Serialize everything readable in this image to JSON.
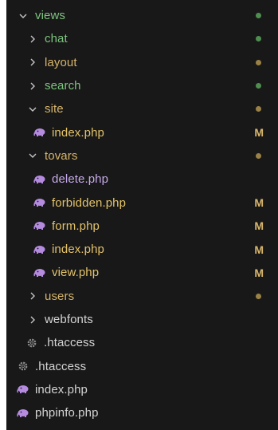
{
  "explorer": {
    "colors": {
      "folder_modified": "#d7b56b",
      "folder_untracked": "#7dc47f",
      "file_modified": "#e2c26a",
      "file_default": "#c5a9e8",
      "dot_green": "#4e8f4f",
      "dot_yellow": "#9a8246",
      "m_badge": "#d7b56b"
    },
    "items": [
      {
        "label": "views",
        "kind": "folder",
        "expanded": true,
        "icon": "chevron-down-icon",
        "status": "dot-green"
      },
      {
        "label": "chat",
        "kind": "folder",
        "expanded": false,
        "icon": "chevron-right-icon",
        "status": "dot-green"
      },
      {
        "label": "layout",
        "kind": "folder",
        "expanded": false,
        "icon": "chevron-right-icon",
        "status": "dot-yellow"
      },
      {
        "label": "search",
        "kind": "folder",
        "expanded": false,
        "icon": "chevron-right-icon",
        "status": "dot-green"
      },
      {
        "label": "site",
        "kind": "folder",
        "expanded": true,
        "icon": "chevron-down-icon",
        "status": "dot-yellow"
      },
      {
        "label": "index.php",
        "kind": "file",
        "icon": "php-elephant-icon",
        "status": "M"
      },
      {
        "label": "tovars",
        "kind": "folder",
        "expanded": true,
        "icon": "chevron-down-icon",
        "status": "dot-yellow"
      },
      {
        "label": "delete.php",
        "kind": "file",
        "icon": "php-elephant-icon",
        "status": ""
      },
      {
        "label": "forbidden.php",
        "kind": "file",
        "icon": "php-elephant-icon",
        "status": "M"
      },
      {
        "label": "form.php",
        "kind": "file",
        "icon": "php-elephant-icon",
        "status": "M"
      },
      {
        "label": "index.php",
        "kind": "file",
        "icon": "php-elephant-icon",
        "status": "M"
      },
      {
        "label": "view.php",
        "kind": "file",
        "icon": "php-elephant-icon",
        "status": "M"
      },
      {
        "label": "users",
        "kind": "folder",
        "expanded": false,
        "icon": "chevron-right-icon",
        "status": "dot-yellow"
      },
      {
        "label": "webfonts",
        "kind": "folder",
        "expanded": false,
        "icon": "chevron-right-icon",
        "status": ""
      },
      {
        "label": ".htaccess",
        "kind": "file",
        "icon": "gear-icon",
        "status": ""
      },
      {
        "label": ".htaccess",
        "kind": "file",
        "icon": "gear-icon",
        "status": ""
      },
      {
        "label": "index.php",
        "kind": "file",
        "icon": "php-elephant-icon",
        "status": ""
      },
      {
        "label": "phpinfo.php",
        "kind": "file",
        "icon": "php-elephant-icon",
        "status": ""
      }
    ],
    "badge_letter": "M"
  }
}
